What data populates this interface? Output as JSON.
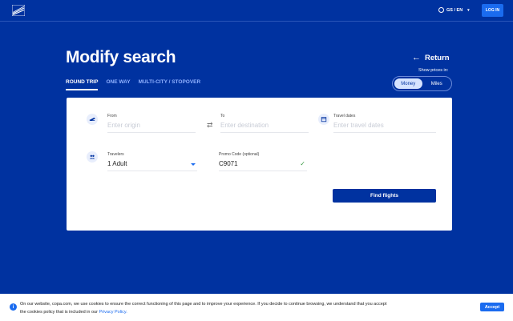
{
  "header": {
    "language": "GS / EN",
    "login_label": "LOG IN"
  },
  "page": {
    "title": "Modify search",
    "return_label": "Return"
  },
  "tabs": [
    {
      "label": "ROUND TRIP",
      "active": true
    },
    {
      "label": "ONE WAY",
      "active": false
    },
    {
      "label": "MULTI-CITY / STOPOVER",
      "active": false
    }
  ],
  "prices": {
    "label": "Show prices in:",
    "options": [
      {
        "label": "Money",
        "active": true
      },
      {
        "label": "Miles",
        "active": false
      }
    ]
  },
  "search": {
    "from": {
      "label": "From",
      "placeholder": "Enter origin",
      "icon": "plane-takeoff-icon"
    },
    "to": {
      "label": "To",
      "placeholder": "Enter destination"
    },
    "dates": {
      "label": "Travel dates",
      "placeholder": "Enter travel dates",
      "icon": "calendar-icon"
    },
    "travelers": {
      "label": "Travelers",
      "value": "1 Adult",
      "icon": "people-icon"
    },
    "promo": {
      "label": "Promo Code (optional)",
      "value": "C9071"
    },
    "find_label": "Find flights"
  },
  "cookie": {
    "text": "On our website, copa.com, we use cookies to ensure the correct functioning of this page and to improve your experience. If you decide to continue browsing, we understand that you accept the cookies policy that is included in our",
    "link": "Privacy Policy.",
    "accept_label": "Accept"
  },
  "colors": {
    "brand_blue": "#0032a0",
    "accent_blue": "#1a6bef"
  }
}
